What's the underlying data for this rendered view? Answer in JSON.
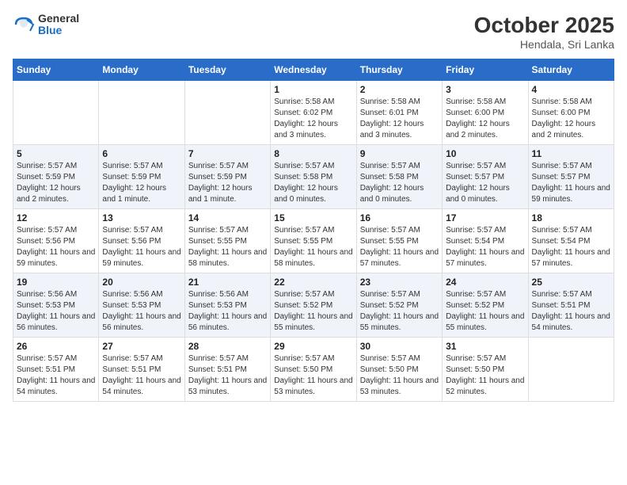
{
  "logo": {
    "general": "General",
    "blue": "Blue"
  },
  "header": {
    "month": "October 2025",
    "location": "Hendala, Sri Lanka"
  },
  "days_of_week": [
    "Sunday",
    "Monday",
    "Tuesday",
    "Wednesday",
    "Thursday",
    "Friday",
    "Saturday"
  ],
  "weeks": [
    [
      {
        "day": "",
        "sunrise": "",
        "sunset": "",
        "daylight": ""
      },
      {
        "day": "",
        "sunrise": "",
        "sunset": "",
        "daylight": ""
      },
      {
        "day": "",
        "sunrise": "",
        "sunset": "",
        "daylight": ""
      },
      {
        "day": "1",
        "sunrise": "Sunrise: 5:58 AM",
        "sunset": "Sunset: 6:02 PM",
        "daylight": "Daylight: 12 hours and 3 minutes."
      },
      {
        "day": "2",
        "sunrise": "Sunrise: 5:58 AM",
        "sunset": "Sunset: 6:01 PM",
        "daylight": "Daylight: 12 hours and 3 minutes."
      },
      {
        "day": "3",
        "sunrise": "Sunrise: 5:58 AM",
        "sunset": "Sunset: 6:00 PM",
        "daylight": "Daylight: 12 hours and 2 minutes."
      },
      {
        "day": "4",
        "sunrise": "Sunrise: 5:58 AM",
        "sunset": "Sunset: 6:00 PM",
        "daylight": "Daylight: 12 hours and 2 minutes."
      }
    ],
    [
      {
        "day": "5",
        "sunrise": "Sunrise: 5:57 AM",
        "sunset": "Sunset: 5:59 PM",
        "daylight": "Daylight: 12 hours and 2 minutes."
      },
      {
        "day": "6",
        "sunrise": "Sunrise: 5:57 AM",
        "sunset": "Sunset: 5:59 PM",
        "daylight": "Daylight: 12 hours and 1 minute."
      },
      {
        "day": "7",
        "sunrise": "Sunrise: 5:57 AM",
        "sunset": "Sunset: 5:59 PM",
        "daylight": "Daylight: 12 hours and 1 minute."
      },
      {
        "day": "8",
        "sunrise": "Sunrise: 5:57 AM",
        "sunset": "Sunset: 5:58 PM",
        "daylight": "Daylight: 12 hours and 0 minutes."
      },
      {
        "day": "9",
        "sunrise": "Sunrise: 5:57 AM",
        "sunset": "Sunset: 5:58 PM",
        "daylight": "Daylight: 12 hours and 0 minutes."
      },
      {
        "day": "10",
        "sunrise": "Sunrise: 5:57 AM",
        "sunset": "Sunset: 5:57 PM",
        "daylight": "Daylight: 12 hours and 0 minutes."
      },
      {
        "day": "11",
        "sunrise": "Sunrise: 5:57 AM",
        "sunset": "Sunset: 5:57 PM",
        "daylight": "Daylight: 11 hours and 59 minutes."
      }
    ],
    [
      {
        "day": "12",
        "sunrise": "Sunrise: 5:57 AM",
        "sunset": "Sunset: 5:56 PM",
        "daylight": "Daylight: 11 hours and 59 minutes."
      },
      {
        "day": "13",
        "sunrise": "Sunrise: 5:57 AM",
        "sunset": "Sunset: 5:56 PM",
        "daylight": "Daylight: 11 hours and 59 minutes."
      },
      {
        "day": "14",
        "sunrise": "Sunrise: 5:57 AM",
        "sunset": "Sunset: 5:55 PM",
        "daylight": "Daylight: 11 hours and 58 minutes."
      },
      {
        "day": "15",
        "sunrise": "Sunrise: 5:57 AM",
        "sunset": "Sunset: 5:55 PM",
        "daylight": "Daylight: 11 hours and 58 minutes."
      },
      {
        "day": "16",
        "sunrise": "Sunrise: 5:57 AM",
        "sunset": "Sunset: 5:55 PM",
        "daylight": "Daylight: 11 hours and 57 minutes."
      },
      {
        "day": "17",
        "sunrise": "Sunrise: 5:57 AM",
        "sunset": "Sunset: 5:54 PM",
        "daylight": "Daylight: 11 hours and 57 minutes."
      },
      {
        "day": "18",
        "sunrise": "Sunrise: 5:57 AM",
        "sunset": "Sunset: 5:54 PM",
        "daylight": "Daylight: 11 hours and 57 minutes."
      }
    ],
    [
      {
        "day": "19",
        "sunrise": "Sunrise: 5:56 AM",
        "sunset": "Sunset: 5:53 PM",
        "daylight": "Daylight: 11 hours and 56 minutes."
      },
      {
        "day": "20",
        "sunrise": "Sunrise: 5:56 AM",
        "sunset": "Sunset: 5:53 PM",
        "daylight": "Daylight: 11 hours and 56 minutes."
      },
      {
        "day": "21",
        "sunrise": "Sunrise: 5:56 AM",
        "sunset": "Sunset: 5:53 PM",
        "daylight": "Daylight: 11 hours and 56 minutes."
      },
      {
        "day": "22",
        "sunrise": "Sunrise: 5:57 AM",
        "sunset": "Sunset: 5:52 PM",
        "daylight": "Daylight: 11 hours and 55 minutes."
      },
      {
        "day": "23",
        "sunrise": "Sunrise: 5:57 AM",
        "sunset": "Sunset: 5:52 PM",
        "daylight": "Daylight: 11 hours and 55 minutes."
      },
      {
        "day": "24",
        "sunrise": "Sunrise: 5:57 AM",
        "sunset": "Sunset: 5:52 PM",
        "daylight": "Daylight: 11 hours and 55 minutes."
      },
      {
        "day": "25",
        "sunrise": "Sunrise: 5:57 AM",
        "sunset": "Sunset: 5:51 PM",
        "daylight": "Daylight: 11 hours and 54 minutes."
      }
    ],
    [
      {
        "day": "26",
        "sunrise": "Sunrise: 5:57 AM",
        "sunset": "Sunset: 5:51 PM",
        "daylight": "Daylight: 11 hours and 54 minutes."
      },
      {
        "day": "27",
        "sunrise": "Sunrise: 5:57 AM",
        "sunset": "Sunset: 5:51 PM",
        "daylight": "Daylight: 11 hours and 54 minutes."
      },
      {
        "day": "28",
        "sunrise": "Sunrise: 5:57 AM",
        "sunset": "Sunset: 5:51 PM",
        "daylight": "Daylight: 11 hours and 53 minutes."
      },
      {
        "day": "29",
        "sunrise": "Sunrise: 5:57 AM",
        "sunset": "Sunset: 5:50 PM",
        "daylight": "Daylight: 11 hours and 53 minutes."
      },
      {
        "day": "30",
        "sunrise": "Sunrise: 5:57 AM",
        "sunset": "Sunset: 5:50 PM",
        "daylight": "Daylight: 11 hours and 53 minutes."
      },
      {
        "day": "31",
        "sunrise": "Sunrise: 5:57 AM",
        "sunset": "Sunset: 5:50 PM",
        "daylight": "Daylight: 11 hours and 52 minutes."
      },
      {
        "day": "",
        "sunrise": "",
        "sunset": "",
        "daylight": ""
      }
    ]
  ]
}
